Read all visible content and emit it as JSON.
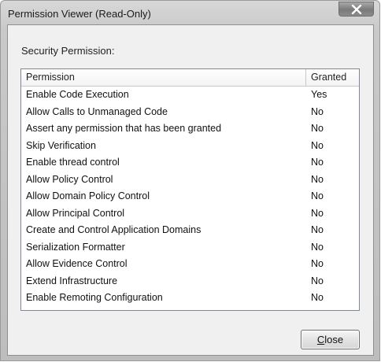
{
  "window": {
    "title": "Permission Viewer (Read-Only)"
  },
  "section": {
    "label": "Security Permission:"
  },
  "table": {
    "columns": [
      "Permission",
      "Granted"
    ],
    "rows": [
      {
        "permission": "Enable Code Execution",
        "granted": "Yes"
      },
      {
        "permission": "Allow Calls to Unmanaged Code",
        "granted": "No"
      },
      {
        "permission": "Assert any permission that has been granted",
        "granted": "No"
      },
      {
        "permission": "Skip Verification",
        "granted": "No"
      },
      {
        "permission": "Enable thread control",
        "granted": "No"
      },
      {
        "permission": "Allow Policy Control",
        "granted": "No"
      },
      {
        "permission": "Allow Domain Policy Control",
        "granted": "No"
      },
      {
        "permission": "Allow Principal Control",
        "granted": "No"
      },
      {
        "permission": "Create and Control Application Domains",
        "granted": "No"
      },
      {
        "permission": "Serialization Formatter",
        "granted": "No"
      },
      {
        "permission": "Allow Evidence Control",
        "granted": "No"
      },
      {
        "permission": "Extend Infrastructure",
        "granted": "No"
      },
      {
        "permission": "Enable Remoting Configuration",
        "granted": "No"
      }
    ]
  },
  "buttons": {
    "close_label_first": "C",
    "close_label_rest": "lose"
  },
  "icons": {
    "titlebar_close": "close-icon"
  }
}
